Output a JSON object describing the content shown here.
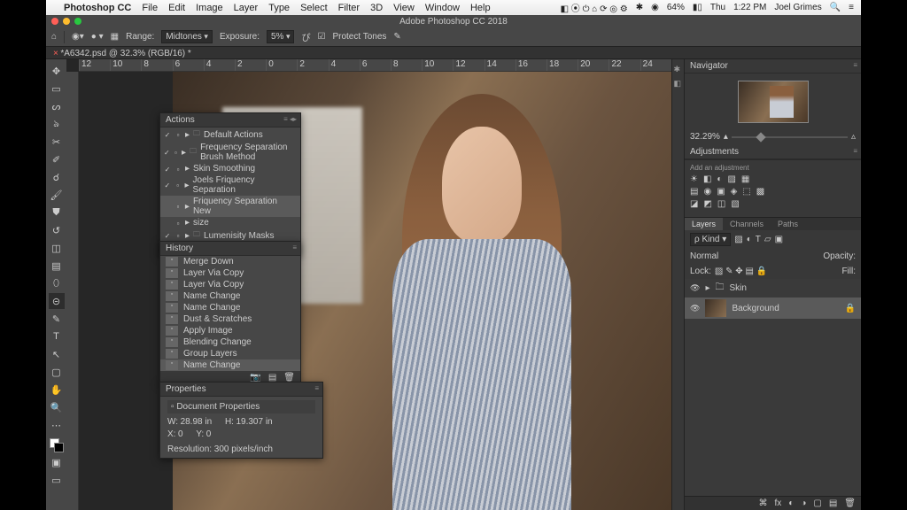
{
  "menubar": {
    "apple": "",
    "app": "Photoshop CC",
    "items": [
      "File",
      "Edit",
      "Image",
      "Layer",
      "Type",
      "Select",
      "Filter",
      "3D",
      "View",
      "Window",
      "Help"
    ],
    "right": {
      "battery": "64%",
      "batt_icon": "⚡︎",
      "day": "Thu",
      "time": "1:22 PM",
      "user": "Joel Grimes"
    }
  },
  "window": {
    "title": "Adobe Photoshop CC 2018"
  },
  "options_bar": {
    "range_label": "Range:",
    "range_value": "Midtones",
    "exposure_label": "Exposure:",
    "exposure_value": "5%",
    "protect": "Protect Tones"
  },
  "doc_tab": "*A6342.psd @ 32.3% (RGB/16) *",
  "ruler_marks": [
    "12",
    "10",
    "8",
    "6",
    "4",
    "2",
    "0",
    "2",
    "4",
    "6",
    "8",
    "10",
    "12",
    "14",
    "16",
    "18",
    "20",
    "22",
    "24"
  ],
  "actions_panel": {
    "title": "Actions",
    "items": [
      {
        "checked": true,
        "folder": true,
        "label": "Default Actions"
      },
      {
        "checked": true,
        "folder": true,
        "label": "Frequency Separation Brush Method"
      },
      {
        "checked": true,
        "folder": false,
        "label": "Skin Smoothing"
      },
      {
        "checked": true,
        "folder": false,
        "label": "Joels Friquency Separation"
      },
      {
        "checked": false,
        "folder": false,
        "label": "Friquency Separation New",
        "selected": true
      },
      {
        "checked": false,
        "folder": false,
        "label": "size"
      },
      {
        "checked": true,
        "folder": true,
        "label": "Lumenisity Masks"
      }
    ]
  },
  "history_panel": {
    "title": "History",
    "items": [
      "Merge Down",
      "Layer Via Copy",
      "Layer Via Copy",
      "Name Change",
      "Name Change",
      "Dust & Scratches",
      "Apply Image",
      "Blending Change",
      "Group Layers",
      "Name Change"
    ]
  },
  "properties_panel": {
    "title": "Properties",
    "subtitle": "Document Properties",
    "w_label": "W:",
    "w": "28.98 in",
    "h_label": "H:",
    "h": "19.307 in",
    "x_label": "X:",
    "x": "0",
    "y_label": "Y:",
    "y": "0",
    "res": "Resolution: 300 pixels/inch"
  },
  "navigator": {
    "title": "Navigator",
    "zoom": "32.29%"
  },
  "adjustments": {
    "title": "Adjustments",
    "hint": "Add an adjustment"
  },
  "layers": {
    "tabs": [
      "Layers",
      "Channels",
      "Paths"
    ],
    "kind": "Kind",
    "opacity_label": "Opacity:",
    "lock_label": "Lock:",
    "fill_label": "Fill:",
    "items": [
      {
        "name": "Skin",
        "group": true
      },
      {
        "name": "Background",
        "group": false,
        "selected": true
      }
    ]
  }
}
